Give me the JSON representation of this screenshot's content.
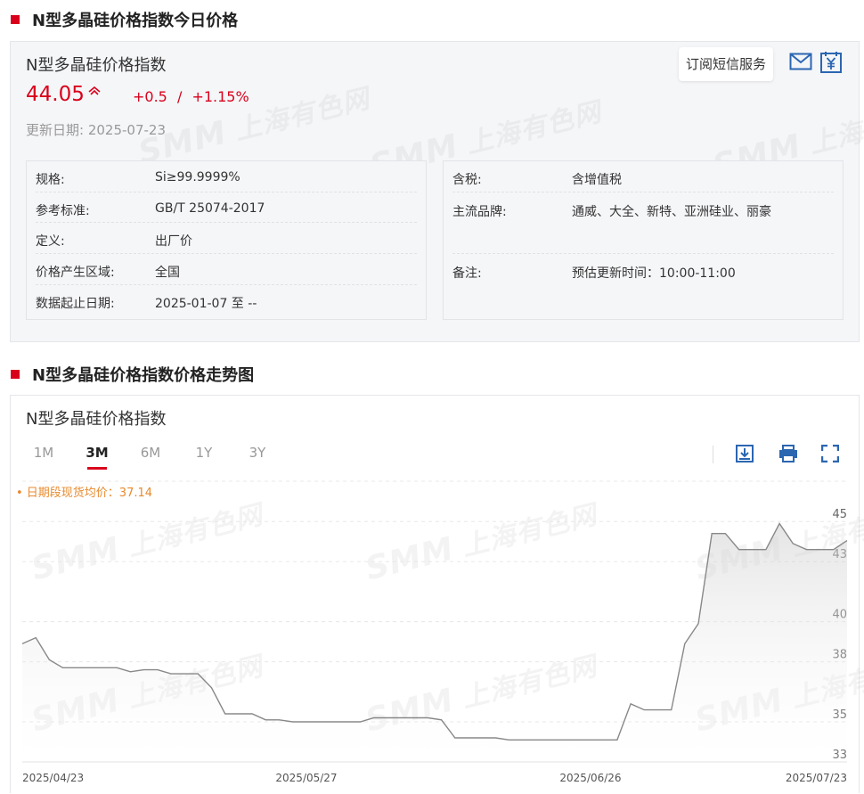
{
  "section1": {
    "title": "N型多晶硅价格指数今日价格"
  },
  "price_panel": {
    "name": "N型多晶硅价格指数",
    "price": "44.05",
    "change": "+0.5",
    "separator": "/",
    "change_pct": "+1.15%",
    "update_date": "更新日期:  2025-07-23",
    "subscribe_label": "订阅短信服务",
    "icons": [
      "mail-icon",
      "yuan-icon"
    ]
  },
  "info_left": [
    {
      "key": "规格:",
      "value": "Si≥99.9999%"
    },
    {
      "key": "参考标准:",
      "value": "GB/T 25074-2017"
    },
    {
      "key": "定义:",
      "value": "出厂价"
    },
    {
      "key": "价格产生区域:",
      "value": "全国"
    },
    {
      "key": "数据起止日期:",
      "value": "2025-01-07 至 --"
    }
  ],
  "info_right": [
    {
      "key": "含税:",
      "value": "含增值税"
    },
    {
      "key": "主流品牌:",
      "value": "通威、大全、新特、亚洲硅业、丽豪"
    },
    {
      "key": "备注:",
      "value": "预估更新时间：10:00-11:00"
    }
  ],
  "section2": {
    "title": "N型多晶硅价格指数价格走势图"
  },
  "chart_panel": {
    "title": "N型多晶硅价格指数",
    "tabs": [
      "1M",
      "3M",
      "6M",
      "1Y",
      "3Y"
    ],
    "active_tab": "3M",
    "tools": [
      "download-icon",
      "print-icon",
      "fullscreen-icon"
    ],
    "avg_label": "• 日期段现货均价：37.14"
  },
  "watermark": {
    "logo": "SMM",
    "text": "上海有色网"
  },
  "colors": {
    "accent": "#d9001b",
    "avg": "#e88a2d",
    "line": "#888888"
  },
  "chart_data": {
    "type": "area",
    "x": [
      "2025-04-23",
      "2025-04-24",
      "2025-04-25",
      "2025-04-28",
      "2025-04-29",
      "2025-04-30",
      "2025-05-06",
      "2025-05-07",
      "2025-05-08",
      "2025-05-09",
      "2025-05-12",
      "2025-05-13",
      "2025-05-14",
      "2025-05-15",
      "2025-05-16",
      "2025-05-19",
      "2025-05-20",
      "2025-05-21",
      "2025-05-22",
      "2025-05-23",
      "2025-05-26",
      "2025-05-27",
      "2025-05-28",
      "2025-05-29",
      "2025-05-30",
      "2025-06-03",
      "2025-06-04",
      "2025-06-05",
      "2025-06-06",
      "2025-06-09",
      "2025-06-10",
      "2025-06-11",
      "2025-06-12",
      "2025-06-13",
      "2025-06-16",
      "2025-06-17",
      "2025-06-18",
      "2025-06-19",
      "2025-06-20",
      "2025-06-23",
      "2025-06-24",
      "2025-06-25",
      "2025-06-26",
      "2025-06-27",
      "2025-06-30",
      "2025-07-01",
      "2025-07-02",
      "2025-07-03",
      "2025-07-04",
      "2025-07-07",
      "2025-07-08",
      "2025-07-09",
      "2025-07-10",
      "2025-07-11",
      "2025-07-14",
      "2025-07-15",
      "2025-07-16",
      "2025-07-17",
      "2025-07-18",
      "2025-07-21",
      "2025-07-22",
      "2025-07-23"
    ],
    "values": [
      38.9,
      39.2,
      38.1,
      37.7,
      37.7,
      37.7,
      37.7,
      37.7,
      37.5,
      37.6,
      37.6,
      37.4,
      37.4,
      37.4,
      36.7,
      35.4,
      35.4,
      35.4,
      35.1,
      35.1,
      35.0,
      35.0,
      35.0,
      35.0,
      35.0,
      35.0,
      35.2,
      35.2,
      35.2,
      35.2,
      35.2,
      35.1,
      34.2,
      34.2,
      34.2,
      34.2,
      34.1,
      34.1,
      34.1,
      34.1,
      34.1,
      34.1,
      34.1,
      34.1,
      34.1,
      35.9,
      35.6,
      35.6,
      35.6,
      38.9,
      39.9,
      44.4,
      44.4,
      43.6,
      43.6,
      43.6,
      44.9,
      43.9,
      43.6,
      43.6,
      43.6,
      44.05
    ],
    "xticks": [
      "2025/04/23",
      "2025/05/27",
      "2025/06/26",
      "2025/07/23"
    ],
    "yticks": [
      "33",
      "35",
      "38",
      "40",
      "43",
      "45"
    ],
    "ylim": [
      33,
      45.5
    ],
    "grid": true,
    "title": "N型多晶硅价格指数"
  }
}
